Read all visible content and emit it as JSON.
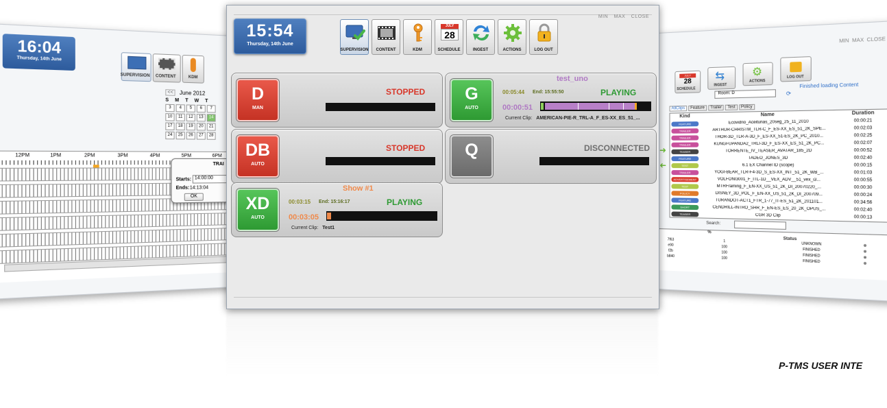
{
  "main": {
    "clock": {
      "time": "15:54",
      "date": "Thursday, 14th June"
    },
    "window_controls": [
      "MIN",
      "MAX",
      "CLOSE"
    ],
    "toolbar": [
      {
        "label": "SUPERVISION",
        "icon": "monitor-check-icon",
        "selected": true
      },
      {
        "label": "CONTENT",
        "icon": "film-icon"
      },
      {
        "label": "KDM",
        "icon": "key-icon"
      },
      {
        "label": "SCHEDULE",
        "icon": "calendar-icon",
        "calendar_month": "JULY",
        "calendar_day": "28"
      },
      {
        "label": "INGEST",
        "icon": "ingest-arrows-icon"
      },
      {
        "label": "ACTIONS",
        "icon": "gear-icon"
      },
      {
        "label": "LOG OUT",
        "icon": "lock-icon"
      }
    ],
    "panels": [
      {
        "letter": "D",
        "mode": "MAN",
        "color": "red",
        "status": "STOPPED",
        "status_color": "#d8372a"
      },
      {
        "letter": "G",
        "mode": "AUTO",
        "color": "green",
        "show": "test_uno",
        "elapsed": "00:05:44",
        "end": "End: 15:55:50",
        "status": "PLAYING",
        "status_color": "#2e9a33",
        "remaining": "00:00:51",
        "remaining_color": "#b07ac4",
        "clip_label": "Current Clip:",
        "clip": "AMERICAN-PIE-R_TRL-A_F_ES-XX_ES_51_..."
      },
      {
        "letter": "DB",
        "mode": "AUTO",
        "color": "red",
        "status": "STOPPED",
        "status_color": "#d8372a"
      },
      {
        "letter": "Q",
        "mode": "",
        "color": "grey",
        "status": "DISCONNECTED",
        "status_color": "#6f6f6f"
      },
      {
        "letter": "XD",
        "mode": "AUTO",
        "color": "green",
        "show": "Show #1",
        "show_color": "#f08a4b",
        "elapsed": "00:03:15",
        "end": "End: 15:16:17",
        "status": "PLAYING",
        "status_color": "#2e9a33",
        "remaining": "00:03:05",
        "remaining_color": "#f08a4b",
        "clip_label": "Current Clip:",
        "clip": "Test1"
      }
    ]
  },
  "left_screen": {
    "clock": {
      "time": "16:04",
      "date": "Thursday, 14th June"
    },
    "toolbar": [
      "SUPERVISION",
      "CONTENT",
      "KDM"
    ],
    "calendar": {
      "nav": "<<",
      "month": "June 2012",
      "weekdays": [
        "S",
        "M",
        "T",
        "W",
        "T"
      ],
      "weeks": [
        [
          "3",
          "4",
          "5",
          "6",
          "7"
        ],
        [
          "10",
          "11",
          "12",
          "13",
          "14"
        ],
        [
          "17",
          "18",
          "19",
          "20",
          "21"
        ],
        [
          "24",
          "25",
          "26",
          "27",
          "28"
        ]
      ]
    },
    "timeline_hours": [
      "12PM",
      "1PM",
      "2PM",
      "3PM",
      "4PM",
      "5PM",
      "6PM"
    ],
    "dialog": {
      "title": "TRAI",
      "starts_label": "Starts:",
      "starts_value": "14:00:00",
      "ends_label": "Ends:",
      "ends_value": "14:13:04",
      "ok": "OK"
    }
  },
  "right_screen": {
    "window_controls": [
      "MIN",
      "MAX",
      "CLOSE"
    ],
    "toolbar": [
      {
        "label": "SCHEDULE",
        "calendar_month": "JULY",
        "calendar_day": "28"
      },
      {
        "label": "INGEST"
      },
      {
        "label": "ACTIONS"
      },
      {
        "label": "LOG OUT"
      }
    ],
    "room": "Room: D",
    "status_message": "Finished loading Content",
    "tabs": [
      "AllClips",
      "Feature",
      "Trailer",
      "Test",
      "Policy"
    ],
    "columns": [
      "Kind",
      "Name",
      "Duration"
    ],
    "clips": [
      {
        "kind": "FEATURE",
        "color": "#4b78c8",
        "name": "Ecovidrio_Aceitunas_20seg_25_11_2010",
        "duration": "00:00:21"
      },
      {
        "kind": "TRAILER",
        "color": "#c8509c",
        "name": "ARTHUR-CHRISTM_TLR-C_F_ES-XX_ES_51_2K_SPE...",
        "duration": "00:02:03"
      },
      {
        "kind": "TRAILER",
        "color": "#c8509c",
        "name": "THOR-3D_TLR-A-3D_F_ES-XX_51-ES_2K_PC_2010...",
        "duration": "00:02:25"
      },
      {
        "kind": "TRAILER",
        "color": "#c8509c",
        "name": "KUNGFUPANDA2_TRLI-3D_F_ES-XX_ES_51_2K_PC...",
        "duration": "00:02:07"
      },
      {
        "kind": "TEASER",
        "color": "#444444",
        "name": "TORRENTE_IV_TEASER_AVATAR_185_2D",
        "duration": "00:00:52"
      },
      {
        "kind": "FEATURE",
        "color": "#4b78c8",
        "name": "TADEO_JONES_3D",
        "duration": "00:02:40"
      },
      {
        "kind": "TEST",
        "color": "#b0c84a",
        "name": "6.1 EX Channel ID (scope)",
        "duration": "00:00:15"
      },
      {
        "kind": "TRAILER",
        "color": "#c8509c",
        "name": "YOGI-BEAR_TLR-F4-3D_S_ES-XX_INT_51_2K_WB_...",
        "duration": "00:01:03"
      },
      {
        "kind": "ADVERTISEMENT",
        "color": "#d8372a",
        "name": "VOLFONI3001_F_ITL-1D__VEX_ADV__51_vex_i3...",
        "duration": "00:00:55"
      },
      {
        "kind": "TEST",
        "color": "#b0c84a",
        "name": "MTRFraming_F_EN-XX_US_51_2K_DI_20070220_...",
        "duration": "00:00:30"
      },
      {
        "kind": "POLICY",
        "color": "#e07a2a",
        "name": "DISNEY_3D_POL_F_EN-XX_US_51_2K_DI_200709...",
        "duration": "00:00:24"
      },
      {
        "kind": "FEATURE",
        "color": "#4b78c8",
        "name": "TURANDOT-ACT1_FTR_1-77_IT-ES_51_2K_201101...",
        "duration": "00:34:56"
      },
      {
        "kind": "SHORT",
        "color": "#3c9a5a",
        "name": "CENDRILL-INTRO_SHR_F_EN-ES_ES_20_2K_OPUS_...",
        "duration": "00:02:40"
      },
      {
        "kind": "TEASER",
        "color": "#444444",
        "name": "CGR 3D Clip",
        "duration": "00:00:13"
      }
    ],
    "search_label": "Search:",
    "ingest_columns": [
      "%",
      "Status"
    ],
    "ingest_rows": [
      {
        "id": "7f63",
        "pct": "1",
        "status": "UNKNOWN"
      },
      {
        "id": "e90",
        "pct": "100",
        "status": "FINISHED"
      },
      {
        "id": "f2b",
        "pct": "100",
        "status": "FINISHED"
      },
      {
        "id": "b840",
        "pct": "100",
        "status": "FINISHED"
      }
    ]
  },
  "caption": "P-TMS USER INTE"
}
